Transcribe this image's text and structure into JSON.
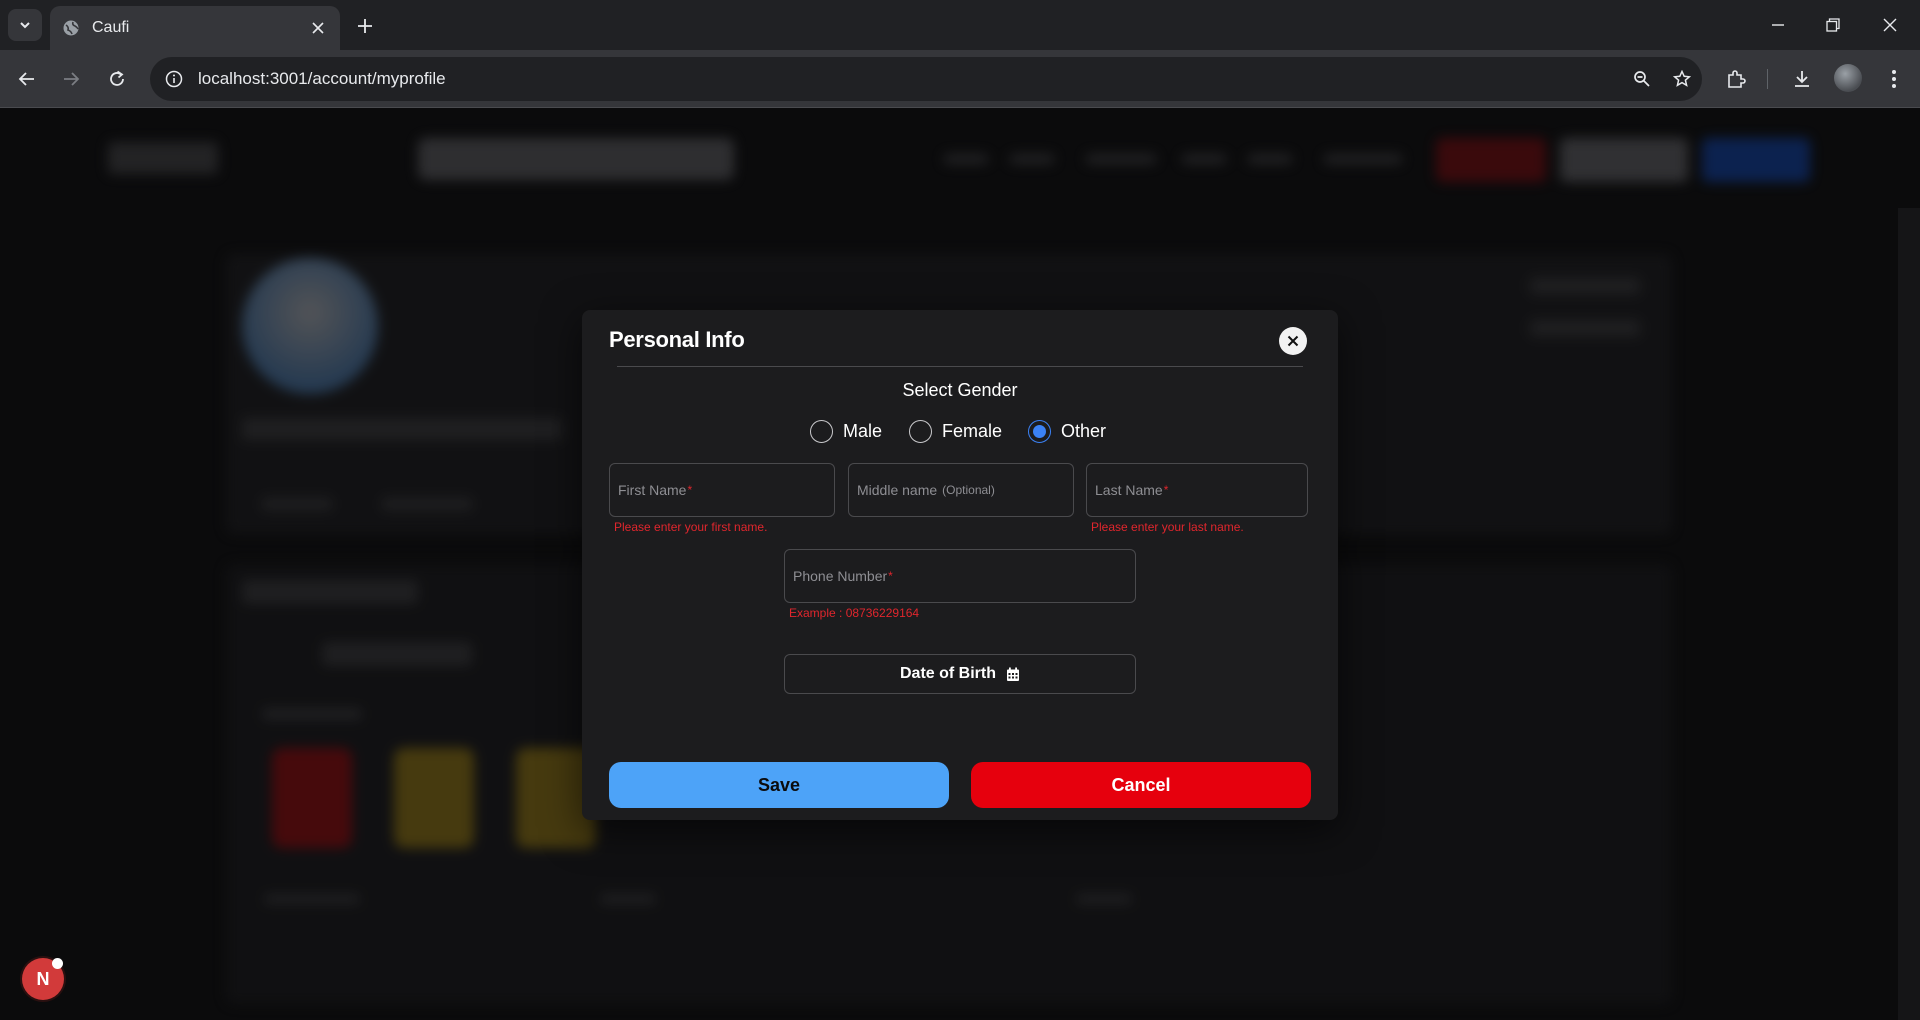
{
  "browser": {
    "tab_title": "Caufi",
    "url": "localhost:3001/account/myprofile"
  },
  "icons": {
    "tab_menu": "chevron-down-icon",
    "tab_favicon": "globe-icon",
    "tab_close": "close-icon",
    "new_tab": "plus-icon",
    "back": "arrow-left-icon",
    "forward": "arrow-right-icon",
    "reload": "reload-icon",
    "site_info": "tune-icon",
    "zoom": "zoom-icon",
    "bookmark": "star-icon",
    "extensions": "puzzle-icon",
    "downloads": "download-icon",
    "menu": "kebab-icon",
    "calendar": "calendar-icon"
  },
  "modal": {
    "title": "Personal Info",
    "gender_label": "Select Gender",
    "genders": [
      {
        "label": "Male",
        "checked": false
      },
      {
        "label": "Female",
        "checked": false
      },
      {
        "label": "Other",
        "checked": true
      }
    ],
    "fields": {
      "first_name": {
        "placeholder": "First Name",
        "required_mark": "*",
        "error": "Please enter your first name."
      },
      "middle_name": {
        "placeholder": "Middle name",
        "optional": "(Optional)"
      },
      "last_name": {
        "placeholder": "Last Name",
        "required_mark": "*",
        "error": "Please enter your last name."
      },
      "phone": {
        "placeholder": "Phone Number",
        "required_mark": "*",
        "hint": "Example : 08736229164"
      }
    },
    "dob_label": "Date of Birth",
    "save_label": "Save",
    "cancel_label": "Cancel"
  },
  "dev_indicator": {
    "letter": "N"
  },
  "colors": {
    "save": "#4da3f8",
    "cancel": "#e6000d",
    "error": "#e0262d",
    "radio_checked": "#3b82f6",
    "modal_bg": "#1c1c1e"
  }
}
